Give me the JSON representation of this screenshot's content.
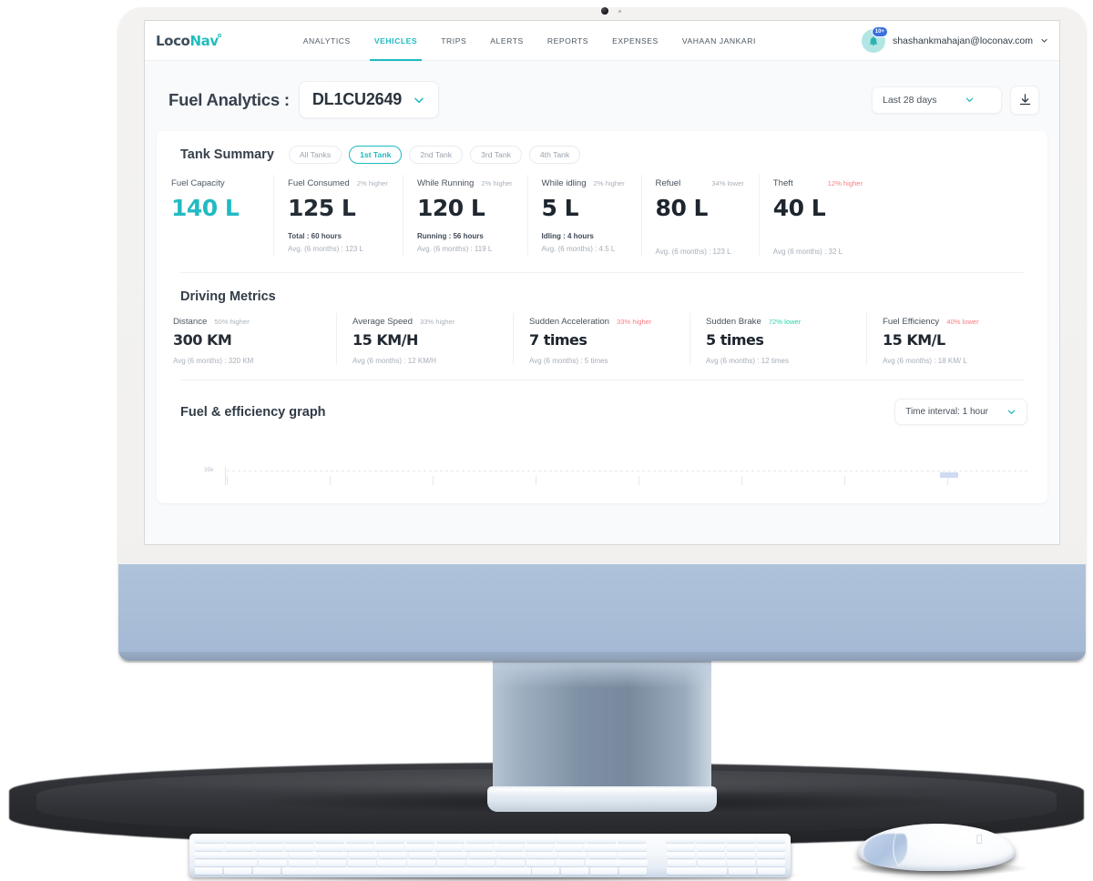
{
  "nav": {
    "logo_text_a": "Loco",
    "logo_text_b": "Nav",
    "links": [
      {
        "label": "ANALYTICS",
        "active": false
      },
      {
        "label": "VEHICLES",
        "active": true
      },
      {
        "label": "TRIPS",
        "active": false
      },
      {
        "label": "ALERTS",
        "active": false
      },
      {
        "label": "REPORTS",
        "active": false
      },
      {
        "label": "EXPENSES",
        "active": false
      },
      {
        "label": "VAHAAN JANKARI",
        "active": false
      }
    ],
    "notification_badge": "10+",
    "user_email": "shashankmahajan@loconav.com"
  },
  "header": {
    "title": "Fuel Analytics :",
    "vehicle": "DL1CU2649",
    "date_range": "Last 28 days"
  },
  "tank_summary": {
    "title": "Tank Summary",
    "chips": [
      {
        "label": "All Tanks",
        "active": false
      },
      {
        "label": "1st Tank",
        "active": true
      },
      {
        "label": "2nd Tank",
        "active": false
      },
      {
        "label": "3rd Tank",
        "active": false
      },
      {
        "label": "4th Tank",
        "active": false
      }
    ],
    "metrics": [
      {
        "label": "Fuel Capacity",
        "delta": "",
        "delta_dir": "none",
        "value": "140 L",
        "value_accent": true,
        "sub1": "",
        "sub2": ""
      },
      {
        "label": "Fuel Consumed",
        "delta": "2% higher",
        "delta_dir": "none",
        "value": "125 L",
        "value_accent": false,
        "sub1": "Total : 60 hours",
        "sub2": "Avg. (6 months) : 123 L"
      },
      {
        "label": "While Running",
        "delta": "2% higher",
        "delta_dir": "none",
        "value": "120 L",
        "value_accent": false,
        "sub1": "Running : 56 hours",
        "sub2": "Avg. (6 months) : 119 L"
      },
      {
        "label": "While idling",
        "delta": "2% higher",
        "delta_dir": "none",
        "value": "5 L",
        "value_accent": false,
        "sub1": "Idling : 4 hours",
        "sub2": "Avg. (6 months) : 4.5 L"
      },
      {
        "label": "Refuel",
        "delta": "34% lower",
        "delta_dir": "none",
        "value": "80 L",
        "value_accent": false,
        "sub1": "",
        "sub2": "Avg. (6 months) : 123 L"
      },
      {
        "label": "Theft",
        "delta": "12% higher",
        "delta_dir": "up",
        "value": "40 L",
        "value_accent": false,
        "sub1": "",
        "sub2": "Avg (6 months) : 32 L"
      }
    ]
  },
  "driving_metrics": {
    "title": "Driving Metrics",
    "metrics": [
      {
        "label": "Distance",
        "delta": "50% higher",
        "delta_dir": "none",
        "value": "300 KM",
        "sub2": "Avg (6 months) : 320 KM"
      },
      {
        "label": "Average Speed",
        "delta": "33% higher",
        "delta_dir": "none",
        "value": "15 KM/H",
        "sub2": "Avg (6 months) : 12 KM/H"
      },
      {
        "label": "Sudden Acceleration",
        "delta": "33% higher",
        "delta_dir": "up",
        "value": "7 times",
        "sub2": "Avg (6 months) : 5 times"
      },
      {
        "label": "Sudden Brake",
        "delta": "72% lower",
        "delta_dir": "down",
        "value": "5 times",
        "sub2": "Avg (6 months) : 12 times"
      },
      {
        "label": "Fuel Efficiency",
        "delta": "40% lower",
        "delta_dir": "up",
        "value": "15 KM/L",
        "sub2": "Avg (6 months) : 18 KM/ L"
      }
    ]
  },
  "graph": {
    "title": "Fuel & efficiency graph",
    "interval": "Time interval: 1 hour",
    "y_tick": "35k"
  },
  "colors": {
    "accent_teal": "#16b8bf",
    "up_red": "#ff7b82",
    "down_green": "#2fd0a5",
    "badge_blue": "#3b6fe0"
  },
  "chart_data": {
    "type": "bar",
    "title": "Fuel & efficiency graph",
    "xlabel": "",
    "ylabel": "",
    "categories": [],
    "values": [],
    "yticks": [
      "35k"
    ],
    "ylim": [
      0,
      35000
    ],
    "grid": true,
    "legend": "none",
    "note": "Chart body is cut off below the visible screen area; only the top gridline and the 35k y-axis tick are rendered."
  }
}
